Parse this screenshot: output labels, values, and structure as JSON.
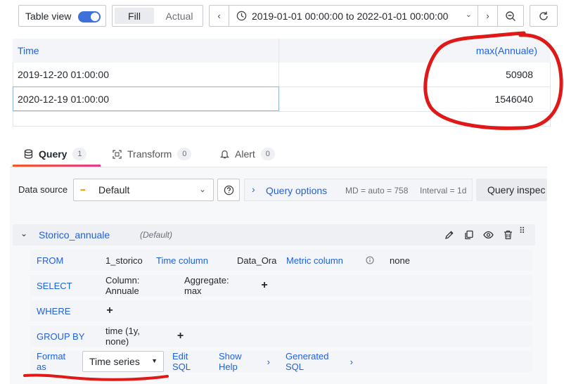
{
  "toolbar": {
    "table_view_label": "Table view",
    "fill_label": "Fill",
    "actual_label": "Actual",
    "time_range": "2019-01-01 00:00:00 to 2022-01-01 00:00:00"
  },
  "table": {
    "columns": [
      "Time",
      "max(Annuale)"
    ],
    "rows": [
      [
        "2019-12-20 01:00:00",
        "50908"
      ],
      [
        "2020-12-19 01:00:00",
        "1546040"
      ]
    ]
  },
  "tabs": [
    {
      "label": "Query",
      "count": "1"
    },
    {
      "label": "Transform",
      "count": "0"
    },
    {
      "label": "Alert",
      "count": "0"
    }
  ],
  "datasource": {
    "label": "Data source",
    "value": "Default",
    "query_options_label": "Query options",
    "md": "MD = auto = 758",
    "interval": "Interval = 1d",
    "inspector_label": "Query inspec"
  },
  "query": {
    "name": "Storico_annuale",
    "datasource_tag": "(Default)",
    "from_label": "FROM",
    "from_table": "1_storico",
    "time_column_label": "Time column",
    "time_column_value": "Data_Ora",
    "metric_column_label": "Metric column",
    "metric_column_value": "none",
    "select_label": "SELECT",
    "select_column": "Column: Annuale",
    "select_aggregate": "Aggregate: max",
    "where_label": "WHERE",
    "groupby_label": "GROUP BY",
    "groupby_value": "time (1y, none)",
    "format_label": "Format as",
    "format_value": "Time series",
    "edit_sql": "Edit SQL",
    "show_help": "Show Help",
    "generated_sql": "Generated SQL"
  },
  "colors": {
    "accent": "#1f62e0",
    "annotation_red": "#e01818",
    "tab_underline": "#f05a28"
  }
}
